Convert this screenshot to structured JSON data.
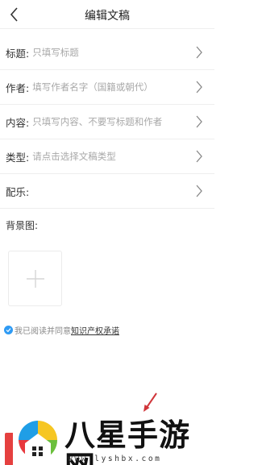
{
  "header": {
    "title": "编辑文稿"
  },
  "form": {
    "rows": [
      {
        "label": "标题:",
        "placeholder": "只填写标题"
      },
      {
        "label": "作者:",
        "placeholder": "填写作者名字（国籍或朝代）"
      },
      {
        "label": "内容:",
        "placeholder": "只填写内容、不要写标题和作者"
      },
      {
        "label": "类型:",
        "placeholder": "请点击选择文稿类型"
      },
      {
        "label": "配乐:",
        "placeholder": ""
      }
    ],
    "background_label": "背景图:"
  },
  "agreement": {
    "prefix": "我已阅读并同意",
    "link": "知识产权承诺"
  },
  "watermark": {
    "brand": "八星手游网",
    "url": "www.lyshbx.com"
  },
  "colors": {
    "accent": "#2f9bf4",
    "divider": "#eeeeee",
    "placeholder": "#a8a8a8",
    "arrow": "#d0353a"
  }
}
